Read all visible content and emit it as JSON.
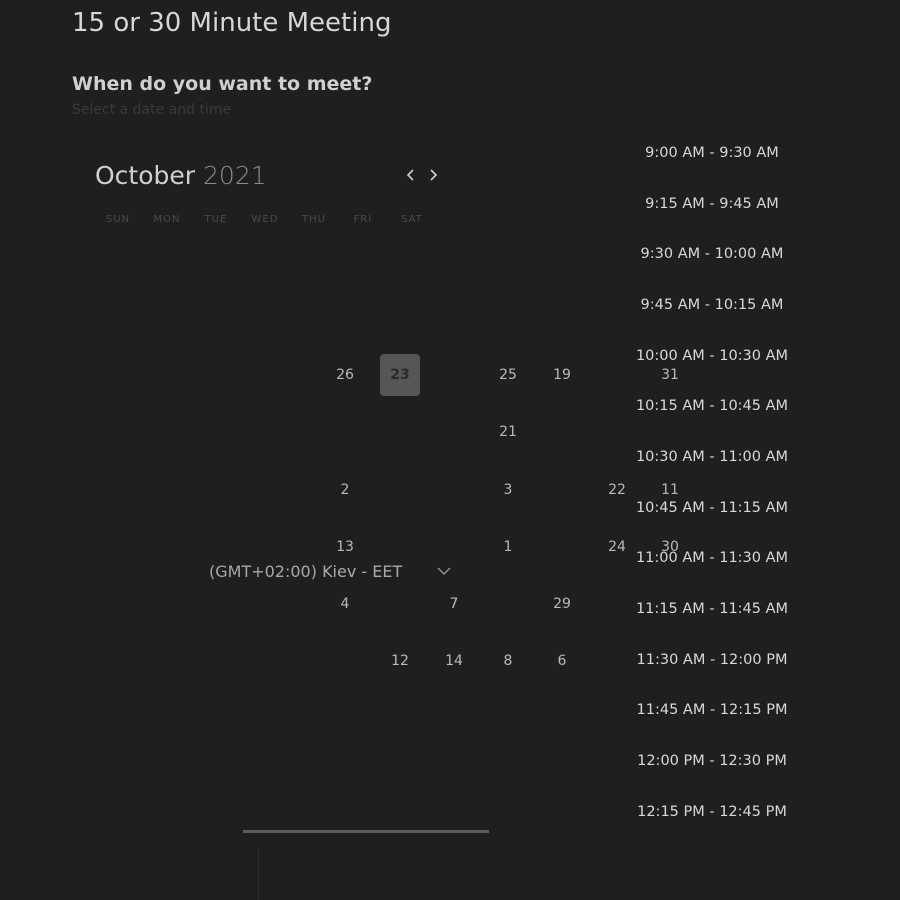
{
  "header": {
    "title": "15 or 30 Minute Meeting",
    "question": "When do you want to meet?",
    "subtitle": "Select a date and time"
  },
  "calendar": {
    "month": "October",
    "year": "2021",
    "weekdays": [
      "SUN",
      "MON",
      "TUE",
      "WED",
      "THU",
      "FRI",
      "SAT"
    ],
    "selected_day": "23",
    "days": [
      "26",
      "23",
      "25",
      "19",
      "31",
      "21",
      "2",
      "3",
      "22",
      "11",
      "13",
      "1",
      "24",
      "30",
      "4",
      "7",
      "29",
      "12",
      "14",
      "8",
      "6"
    ]
  },
  "timezone": {
    "label": "(GMT+02:00) Kiev - EET"
  },
  "time_slots": [
    "9:00 AM - 9:30 AM",
    "9:15 AM - 9:45 AM",
    "9:30 AM - 10:00 AM",
    "9:45 AM - 10:15 AM",
    "10:00 AM - 10:30 AM",
    "10:15 AM - 10:45 AM",
    "10:30 AM - 11:00 AM",
    "10:45 AM - 11:15 AM",
    "11:00 AM - 11:30 AM",
    "11:15 AM - 11:45 AM",
    "11:30 AM - 12:00 PM",
    "11:45 AM - 12:15 PM",
    "12:00 PM - 12:30 PM",
    "12:15 PM - 12:45 PM"
  ],
  "icons": {
    "prev": "chevron-left-icon",
    "next": "chevron-right-icon",
    "dropdown": "chevron-down-icon"
  },
  "colors": {
    "background": "#1f1f1f",
    "selected_day": "#565656"
  }
}
